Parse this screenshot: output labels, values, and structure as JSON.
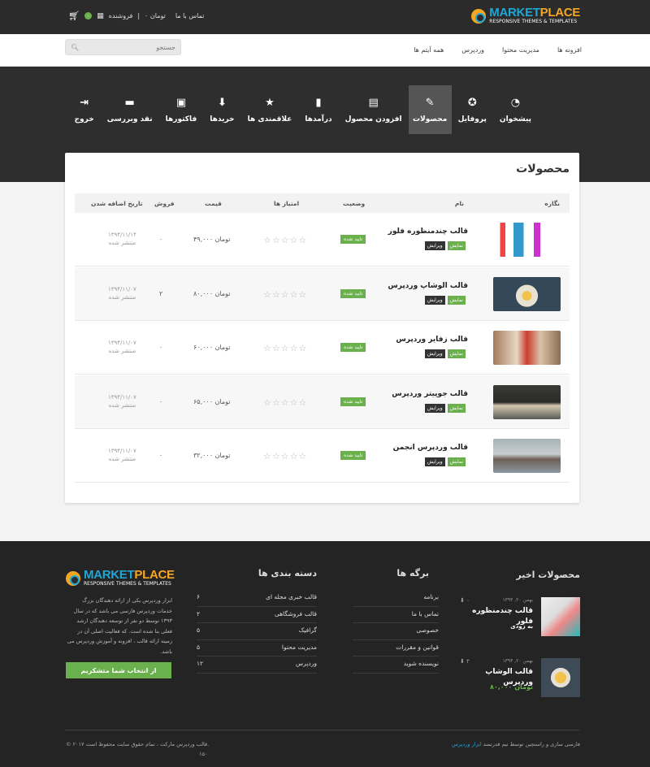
{
  "header": {
    "logo_market": "MARKET",
    "logo_place": "PLACE",
    "logo_sub": "RESPONSIVE THEMES & TEMPLATES",
    "contact": "تماس با ما",
    "cart_total": "۰ تومان",
    "seller": "فروشنده",
    "cart_count": "۰"
  },
  "search": {
    "placeholder": "جستجو"
  },
  "mainnav": [
    "افزونه ها",
    "مدیریت محتوا",
    "وردپرس",
    "همه آیتم ها"
  ],
  "tabs": [
    {
      "label": "پیشخوان",
      "icon": "dashboard-icon",
      "glyph": "◔"
    },
    {
      "label": "پروفایل",
      "icon": "badge-icon",
      "glyph": "✪"
    },
    {
      "label": "محصولات",
      "icon": "edit-icon",
      "glyph": "✎"
    },
    {
      "label": "افزودن محصول",
      "icon": "add-document-icon",
      "glyph": "▤"
    },
    {
      "label": "درآمدها",
      "icon": "bar-chart-icon",
      "glyph": "▮"
    },
    {
      "label": "علاقمندی ها",
      "icon": "star-icon",
      "glyph": "★"
    },
    {
      "label": "خریدها",
      "icon": "download-icon",
      "glyph": "⬇"
    },
    {
      "label": "فاکتورها",
      "icon": "invoice-icon",
      "glyph": "▣"
    },
    {
      "label": "نقد وبررسی",
      "icon": "comment-icon",
      "glyph": "▬"
    },
    {
      "label": "خروج",
      "icon": "logout-icon",
      "glyph": "⇥"
    }
  ],
  "panel": {
    "title": "محصولات",
    "columns": {
      "image": "نگاره",
      "name": "نام",
      "status": "وضعیت",
      "rating": "امتیاز ها",
      "price": "قیمت",
      "sales": "فروش",
      "date": "تاریخ اضافه شدن"
    },
    "rows": [
      {
        "name": "قالب چندمنظوره فلور",
        "status": "تایید شده",
        "price": "۴۹,۰۰۰ تومان",
        "sales": "۰",
        "date": "۱۳۹۴/۱۱/۱۴",
        "state": "منتشر شده",
        "show": "نمایش",
        "edit": "ویرایش"
      },
      {
        "name": "قالب الوشاپ وردپرس",
        "status": "تایید شده",
        "price": "۸۰,۰۰۰ تومان",
        "sales": "۲",
        "date": "۱۳۹۴/۱۱/۰۷",
        "state": "منتشر شده",
        "show": "نمایش",
        "edit": "ویرایش"
      },
      {
        "name": "قالب زفایر وردپرس",
        "status": "تایید شده",
        "price": "۶۰,۰۰۰ تومان",
        "sales": "۰",
        "date": "۱۳۹۴/۱۱/۰۷",
        "state": "منتشر شده",
        "show": "نمایش",
        "edit": "ویرایش"
      },
      {
        "name": "قالب جوپیتر وردپرس",
        "status": "تایید شده",
        "price": "۶۵,۰۰۰ تومان",
        "sales": "۰",
        "date": "۱۳۹۴/۱۱/۰۷",
        "state": "منتشر شده",
        "show": "نمایش",
        "edit": "ویرایش"
      },
      {
        "name": "قالب وردپرس انجمن",
        "status": "تایید شده",
        "price": "۳۲,۰۰۰ تومان",
        "sales": "۰",
        "date": "۱۳۹۴/۱۱/۰۷",
        "state": "منتشر شده",
        "show": "نمایش",
        "edit": "ویرایش"
      }
    ]
  },
  "footer": {
    "recent_title": "محصولات اخیر",
    "pages_title": "برگه ها",
    "cats_title": "دسته بندی ها",
    "recent": [
      {
        "meta": "بهمن ۲۰, ۱۳۹۴",
        "downloads": "۰",
        "name": "قالب چندمنظوره فلور",
        "extra": "به زودی"
      },
      {
        "meta": "بهمن ۲۰, ۱۳۹۴",
        "downloads": "۲",
        "name": "قالب الوشاپ وردپرس",
        "extra": "۸۰,۰۰۰ تومان"
      }
    ],
    "pages": [
      "برنامه",
      "تماس با ما",
      "خصوصی",
      "قوانین و مقررات",
      "نویسنده شوید"
    ],
    "cats": [
      {
        "name": "قالب خبری مجله ای",
        "count": "۶"
      },
      {
        "name": "قالب فروشگاهی",
        "count": "۲"
      },
      {
        "name": "گرافیک",
        "count": "۵"
      },
      {
        "name": "مدیریت محتوا",
        "count": "۵"
      },
      {
        "name": "وردپرس",
        "count": "۱۲"
      }
    ],
    "about": "ابزار وردپرس یکی از ارائه دهندگان بزرگ خدمات وردپرس فارسی می باشد که در سال ۱۳۹۳ توسط دو نفر از توسعه دهندگان ارشد فعلی بنا شده است. که فعالیت اصلی آن در زمینه ارائه قالب ، افزونه و آموزش وردپرس می باشد.",
    "cta": "از انتخاب شما متشکریم",
    "credit": "فارسی سازی و راستچین توسط تیم قدرتمند",
    "credit_link": "ابزار وردپرس",
    "copyright": "© ۲۰۱۷ قالب وردپرس مارکت ، تمام حقوق سایت محفوظ است.",
    "counter": "۱۵۰"
  },
  "colors": {
    "accent": "#6ab04c",
    "brand_blue": "#1fa7d6",
    "brand_orange": "#f5a623",
    "dark": "#2e2e2e"
  }
}
